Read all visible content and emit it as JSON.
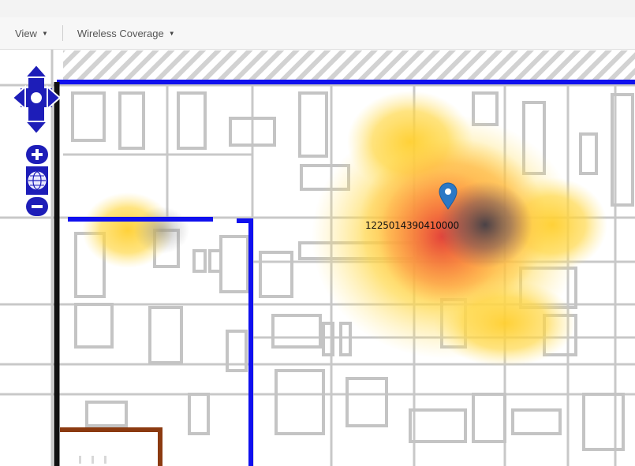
{
  "toolbar": {
    "view_label": "View",
    "coverage_label": "Wireless Coverage"
  },
  "map": {
    "device_id": "1225014390410000",
    "icons": {
      "pan": "pan-arrows-icon",
      "zoom_in": "zoom-in-icon",
      "zoom_reset": "globe-icon",
      "zoom_out": "zoom-out-icon",
      "marker": "location-pin-icon"
    },
    "colors": {
      "boundary": "#1010ee",
      "wall": "#111111",
      "room": "#8b3a10",
      "heat_hot": "#c62828",
      "heat_warm": "#ffa000",
      "heat_cool": "#ffd54f",
      "marker": "#2b78c5",
      "controls": "#1d1db8"
    }
  }
}
